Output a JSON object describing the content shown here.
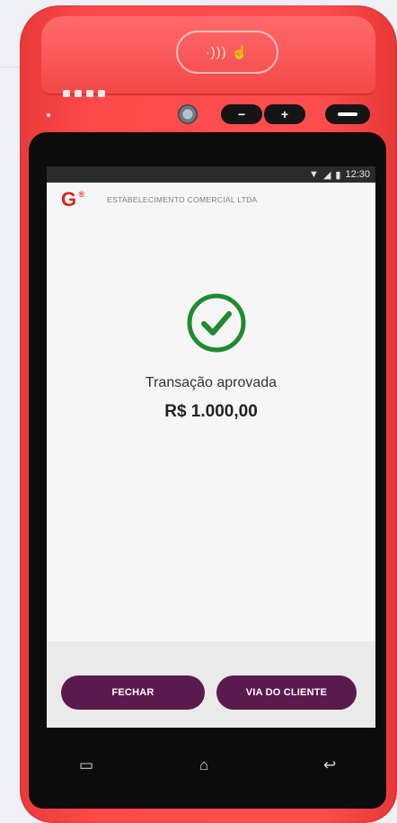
{
  "statusbar": {
    "time": "12:30"
  },
  "app": {
    "logo": "G",
    "logo_mark": "®",
    "merchant": "ESTABELECIMENTO COMERCIAL LTDA"
  },
  "result": {
    "message": "Transação aprovada",
    "amount": "R$ 1.000,00"
  },
  "actions": {
    "close_label": "FECHAR",
    "client_copy_label": "VIA DO CLIENTE"
  },
  "hardware": {
    "nfc_symbol": "·))) ☝",
    "minus": "−",
    "plus": "+"
  },
  "icons": {
    "nav_menu": "▭",
    "nav_home": "⌂",
    "nav_back": "↩"
  },
  "colors": {
    "device": "#ff4a4a",
    "brand_red": "#e0201e",
    "success_green": "#1f8a2e",
    "button_purple": "#5b1a4d"
  }
}
